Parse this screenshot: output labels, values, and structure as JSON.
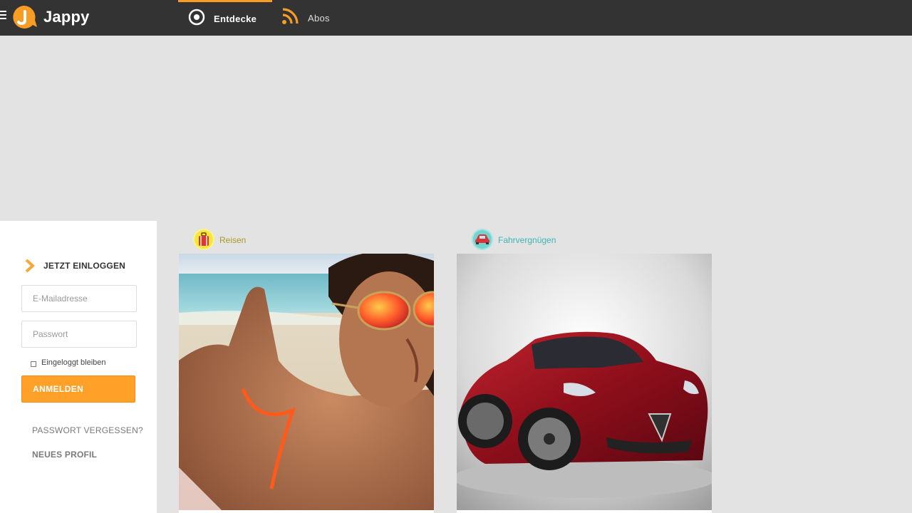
{
  "header": {
    "logo_text": "Jappy",
    "tabs": [
      {
        "label": "Entdecke",
        "active": true,
        "icon": "compass-circle-icon"
      },
      {
        "label": "Abos",
        "active": false,
        "icon": "rss-feed-icon"
      }
    ],
    "accent_color": "#f79d25",
    "background_color": "#333333"
  },
  "login": {
    "heading": "JETZT EINLOGGEN",
    "email_placeholder": "E-Mailadresse",
    "password_placeholder": "Passwort",
    "remember_label": "Eingeloggt bleiben",
    "submit_label": "ANMELDEN",
    "forgot_label": "PASSWORT VERGESSEN?",
    "new_profile_label": "NEUES PROFIL",
    "button_color": "#ffa028"
  },
  "feed": {
    "cards": [
      {
        "category": "Reisen",
        "category_color": "#a89a26",
        "icon": "suitcase-icon",
        "image": "beach-selfie-photo"
      },
      {
        "category": "Fahrvergnügen",
        "category_color": "#3db5b0",
        "icon": "red-car-icon",
        "image": "red-sports-car-photo"
      }
    ]
  }
}
